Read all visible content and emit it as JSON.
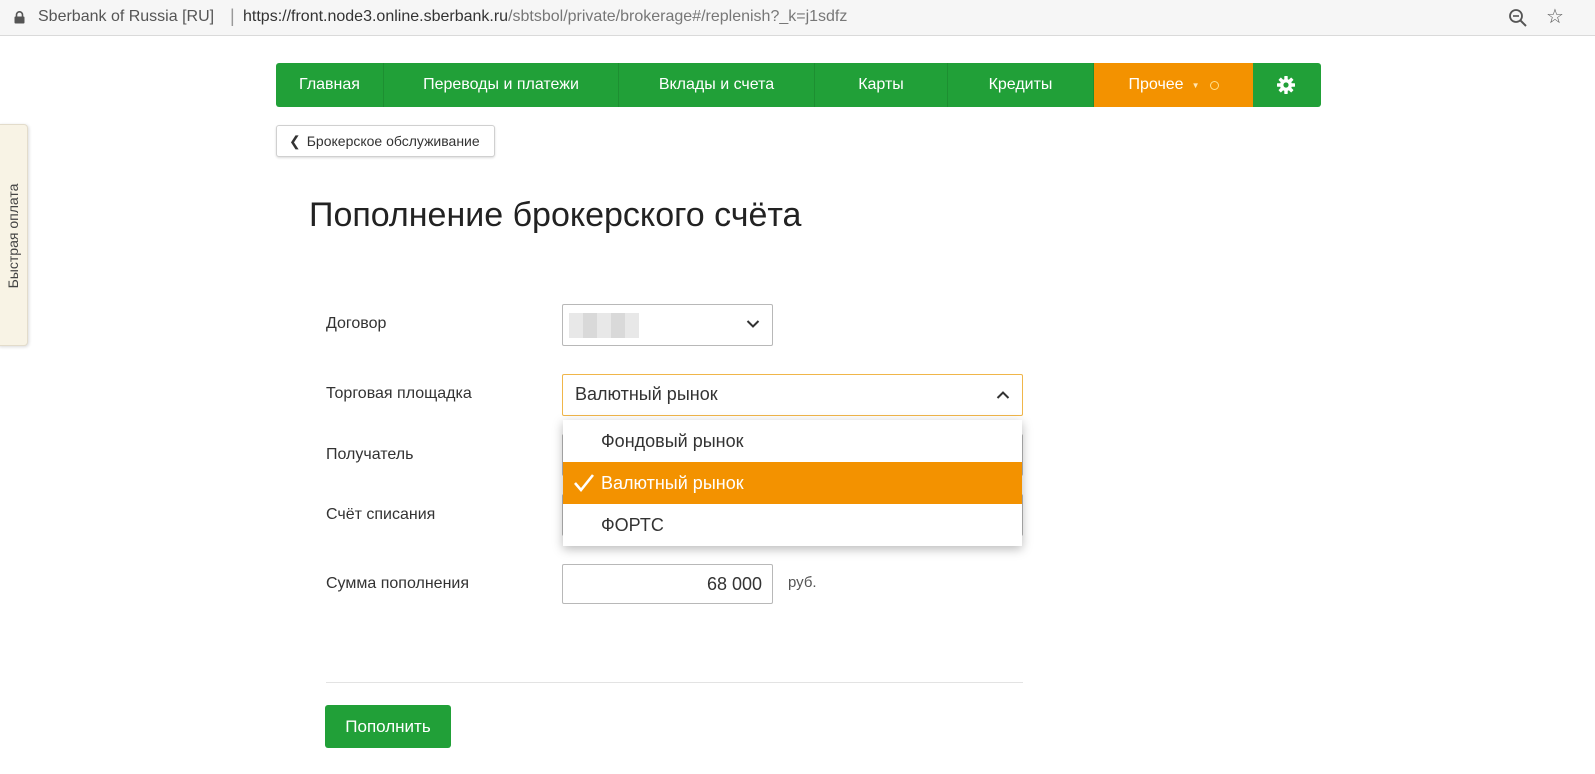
{
  "browser": {
    "site_name": "Sberbank of Russia [RU]",
    "separator": "|",
    "url_host": "https://front.node3.online.sberbank.ru",
    "url_path": "/sbtsbol/private/brokerage#/replenish?_k=j1sdfz"
  },
  "side_tab": {
    "label": "Быстрая оплата"
  },
  "nav": {
    "items": [
      {
        "label": "Главная"
      },
      {
        "label": "Переводы и платежи"
      },
      {
        "label": "Вклады и счета"
      },
      {
        "label": "Карты"
      },
      {
        "label": "Кредиты"
      }
    ],
    "more_label": "Прочее",
    "more_color": "#f39200",
    "brand_color": "#21a038"
  },
  "back_button": {
    "label": "Брокерское обслуживание"
  },
  "page_title": "Пополнение брокерского счёта",
  "form": {
    "contract_label": "Договор",
    "market_label": "Торговая площадка",
    "market_value": "Валютный рынок",
    "recipient_label": "Получатель",
    "debit_label": "Счёт списания",
    "amount_label": "Сумма пополнения",
    "amount_value": "68 000",
    "currency": "руб.",
    "submit_label": "Пополнить"
  },
  "market_options": [
    {
      "label": "Фондовый рынок",
      "selected": false
    },
    {
      "label": "Валютный рынок",
      "selected": true
    },
    {
      "label": "ФОРТС",
      "selected": false
    }
  ]
}
